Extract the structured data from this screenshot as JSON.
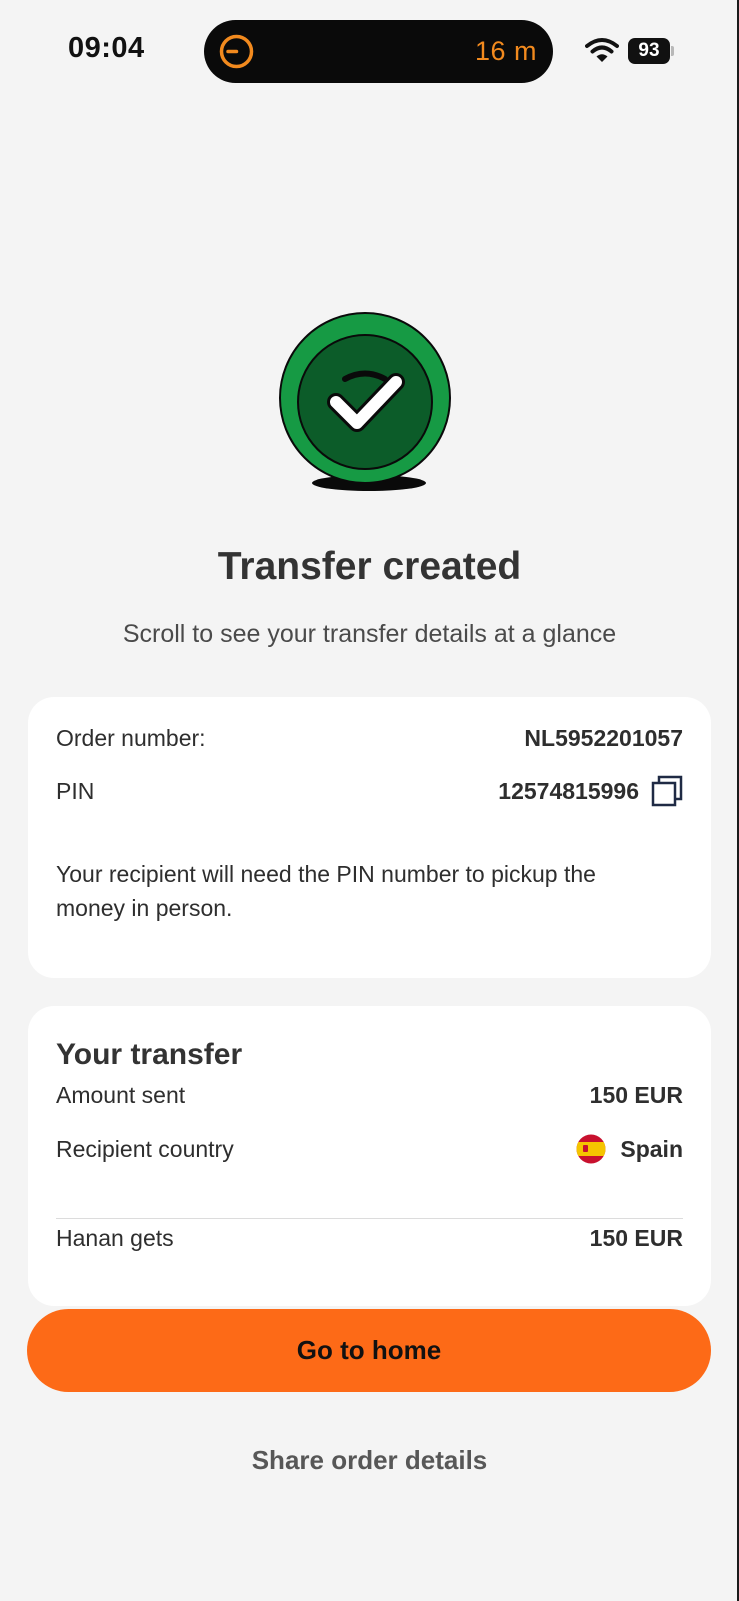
{
  "status_bar": {
    "time": "09:04",
    "island_timer": "16 m",
    "battery": "93"
  },
  "hero": {
    "title": "Transfer created",
    "subtitle": "Scroll to see your transfer details at a glance"
  },
  "order_card": {
    "order_label": "Order number:",
    "order_value": "NL5952201057",
    "pin_label": "PIN",
    "pin_value": "12574815996",
    "note": "Your recipient will need the PIN number to pickup the money in person."
  },
  "transfer_card": {
    "heading": "Your transfer",
    "amount_label": "Amount sent",
    "amount_value": "150 EUR",
    "country_label": "Recipient country",
    "country_value": "Spain",
    "recipient_label": "Hanan gets",
    "recipient_value": "150 EUR"
  },
  "actions": {
    "home_label": "Go to home",
    "share_label": "Share order details"
  },
  "colors": {
    "accent": "#fd6a17",
    "success_green": "#169a44",
    "success_dark": "#0c5c29",
    "timer_orange": "#f28a1e"
  },
  "icons": [
    "timer-icon",
    "wifi-icon",
    "battery-icon",
    "checkmark-icon",
    "copy-icon",
    "spain-flag-icon"
  ]
}
